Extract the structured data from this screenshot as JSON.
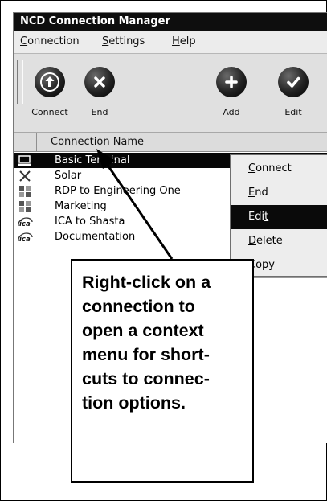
{
  "window": {
    "title": "NCD Connection Manager"
  },
  "menubar": [
    {
      "label": "Connection",
      "mnemonic": "C",
      "rest": "onnection"
    },
    {
      "label": "Settings",
      "mnemonic": "S",
      "rest": "ettings"
    },
    {
      "label": "Help",
      "mnemonic": "H",
      "rest": "elp"
    }
  ],
  "toolbar": {
    "buttons": [
      {
        "label": "Connect",
        "icon": "arrow-up-icon"
      },
      {
        "label": "End",
        "icon": "x-icon"
      },
      {
        "label": "Add",
        "icon": "plus-icon"
      },
      {
        "label": "Edit",
        "icon": "check-icon"
      }
    ]
  },
  "list": {
    "column_header": "Connection Name",
    "rows": [
      {
        "label": "Basic Terminal",
        "icon": "terminal-icon",
        "selected": true
      },
      {
        "label": "Solar",
        "icon": "x-window-icon",
        "selected": false
      },
      {
        "label": "RDP to Engineering One",
        "icon": "rdp-icon",
        "selected": false
      },
      {
        "label": "Marketing",
        "icon": "rdp-icon",
        "selected": false
      },
      {
        "label": "ICA to Shasta",
        "icon": "ica-icon",
        "selected": false
      },
      {
        "label": "Documentation",
        "icon": "ica-icon",
        "selected": false
      }
    ]
  },
  "context_menu": {
    "items": [
      {
        "label": "Connect",
        "mnemonic_index": 0,
        "highlighted": false
      },
      {
        "label": "End",
        "mnemonic_index": 0,
        "highlighted": false
      },
      {
        "label": "Edit",
        "mnemonic_index": 3,
        "highlighted": true
      },
      {
        "label": "Delete",
        "mnemonic_index": 0,
        "highlighted": false
      },
      {
        "label": "Copy",
        "mnemonic_index": 3,
        "highlighted": false
      }
    ]
  },
  "callout": {
    "text": "Right-click on a\nconnection to\nopen a context\nmenu for short-\ncuts to connec-\ntion options."
  },
  "colors": {
    "selection": "#070707",
    "title_bar": "#0e0e0e",
    "menu_bg": "#ececec"
  }
}
